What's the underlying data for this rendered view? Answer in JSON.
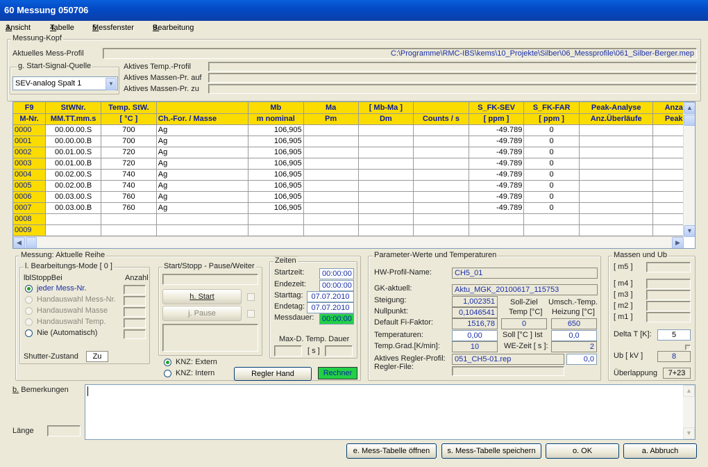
{
  "window": {
    "title": "60  Messung 050706"
  },
  "menu": [
    {
      "key": "3.",
      "label": "Ansicht"
    },
    {
      "key": "4.",
      "label": "Tabelle"
    },
    {
      "key": "5.",
      "label": "Messfenster"
    },
    {
      "key": "9.",
      "label": "Bearbeitung"
    }
  ],
  "kopf": {
    "legend": "Messung-Kopf",
    "profil_label": "Aktuelles Mess-Profil",
    "profil_value": "C:\\Programme\\RMC-IBS\\kems\\10_Projekte\\Silber\\06_Messprofile\\061_Silber-Berger.mep",
    "start_signal_legend": "g. Start-Signal-Quelle",
    "start_signal_value": "SEV-analog Spalt 1",
    "temp_profil_label": "Aktives Temp.-Profil",
    "massen_auf_label": "Aktives Massen-Pr. auf",
    "massen_zu_label": "Aktives Massen-Pr. zu"
  },
  "table": {
    "headers1": [
      "F9",
      "StWNr.",
      "Temp. StW.",
      "",
      "Mb",
      "Ma",
      "[ Mb-Ma ]",
      "",
      "S_FK-SEV",
      "S_FK-FAR",
      "Peak-Analyse",
      "Anza"
    ],
    "headers2": [
      "M-Nr.",
      "MM.TT.mm.s",
      "[ °C ]",
      "Ch.-For. / Masse",
      "m nominal",
      "Pm",
      "Dm",
      "Counts / s",
      "[ ppm ]",
      "[ ppm ]",
      "Anz.Überläufe",
      "Peak"
    ],
    "rows": [
      [
        "0000",
        "00.00.00.S",
        "700",
        "Ag",
        "106,905",
        "",
        "",
        "",
        "-49.789",
        "0",
        "",
        ""
      ],
      [
        "0001",
        "00.00.00.B",
        "700",
        "Ag",
        "106,905",
        "",
        "",
        "",
        "-49.789",
        "0",
        "",
        ""
      ],
      [
        "0002",
        "00.01.00.S",
        "720",
        "Ag",
        "106,905",
        "",
        "",
        "",
        "-49.789",
        "0",
        "",
        ""
      ],
      [
        "0003",
        "00.01.00.B",
        "720",
        "Ag",
        "106,905",
        "",
        "",
        "",
        "-49.789",
        "0",
        "",
        ""
      ],
      [
        "0004",
        "00.02.00.S",
        "740",
        "Ag",
        "106,905",
        "",
        "",
        "",
        "-49.789",
        "0",
        "",
        ""
      ],
      [
        "0005",
        "00.02.00.B",
        "740",
        "Ag",
        "106,905",
        "",
        "",
        "",
        "-49.789",
        "0",
        "",
        ""
      ],
      [
        "0006",
        "00.03.00.S",
        "760",
        "Ag",
        "106,905",
        "",
        "",
        "",
        "-49.789",
        "0",
        "",
        ""
      ],
      [
        "0007",
        "00.03.00.B",
        "760",
        "Ag",
        "106,905",
        "",
        "",
        "",
        "-49.789",
        "0",
        "",
        ""
      ],
      [
        "0008",
        "",
        "",
        "",
        "",
        "",
        "",
        "",
        "",
        "",
        "",
        ""
      ],
      [
        "0009",
        "",
        "",
        "",
        "",
        "",
        "",
        "",
        "",
        "",
        "",
        ""
      ]
    ]
  },
  "messung": {
    "legend": "Messung:  Aktuelle Reihe",
    "mode_legend": "l. Bearbeitungs-Mode   [ 0 ]",
    "lbl_stopp": "lblStoppBei",
    "anzahl": "Anzahl",
    "options": [
      "jeder Mess-Nr.",
      "Handauswahl Mess-Nr.",
      "Handauswahl Masse",
      "Handauswahl Temp.",
      "Nie (Automatisch)"
    ],
    "shutter_label": "Shutter-Zustand",
    "shutter_value": "Zu",
    "startstopp_legend": "Start/Stopp - Pause/Weiter",
    "start_btn": "h. Start",
    "pause_btn": "j. Pause",
    "knz_extern": "KNZ: Extern",
    "knz_intern": "KNZ: Intern",
    "regler_hand": "Regler Hand",
    "rechner": "Rechner"
  },
  "zeiten": {
    "legend": "Zeiten",
    "startzeit_label": "Startzeit:",
    "startzeit": "00:00:00",
    "endezeit_label": "Endezeit:",
    "endezeit": "00:00:00",
    "starttag_label": "Starttag:",
    "starttag": "07.07.2010",
    "endetag_label": "Endetag:",
    "endetag": "07.07.2010",
    "messdauer_label": "Messdauer:",
    "messdauer": "00:00:00",
    "maxd_label": "Max-D. Temp. Dauer",
    "maxd_unit": "[ s ]"
  },
  "param": {
    "legend": "Parameter-Werte und Temperaturen",
    "hw_label": "HW-Profil-Name:",
    "hw_value": "CH5_01",
    "gk_label": "GK-aktuell:",
    "gk_value": "Aktu_MGK_20100617_115753",
    "steigung_label": "Steigung:",
    "steigung": "1,002351",
    "nullpunkt_label": "Nullpunkt:",
    "nullpunkt": "0,1046541",
    "fifaktor_label": "Default Fi-Faktor:",
    "fifaktor": "1516,78",
    "soll_ziel_label": "Soll-Ziel",
    "temp_c_label": "Temp [°C]",
    "umsch_label": "Umsch.-Temp.",
    "heizung_label": "Heizung [°C]",
    "soll_ziel": "0",
    "heizung": "650",
    "temperaturen_label": "Temperaturen:",
    "temperaturen": "0,00",
    "soll_label": "Soll  [°C ]  Ist",
    "ist": "0,0",
    "tempgrad_label": "Temp.Grad.[K/min]:",
    "tempgrad": "10",
    "wezeit_label": "WE-Zeit [ s ]:",
    "wezeit": "2",
    "regler_profil_label": "Aktives Regler-Profil:",
    "regler_profil": "051_CH5-01.rep",
    "regler_val": "0,0",
    "regler_file_label": "Regler-File:"
  },
  "massen": {
    "legend": "Massen und Ub",
    "labels": [
      "[ m5 ]",
      "[ m4 ]",
      "[ m3 ]",
      "[ m2 ]",
      "[ m1 ]"
    ],
    "delta_label": "Delta T [K]:",
    "delta": "5",
    "ub_label": "Ub [ kV ]",
    "ub": "8",
    "ueberlappung_label": "Überlappung",
    "ueberlappung": "7+23"
  },
  "bemerkungen": {
    "label": "b. Bemerkungen",
    "laenge_label": "Länge"
  },
  "buttons": {
    "oeffnen": "e. Mess-Tabelle öffnen",
    "speichern": "s. Mess-Tabelle speichern",
    "ok": "o. OK",
    "abbruch": "a. Abbruch"
  }
}
